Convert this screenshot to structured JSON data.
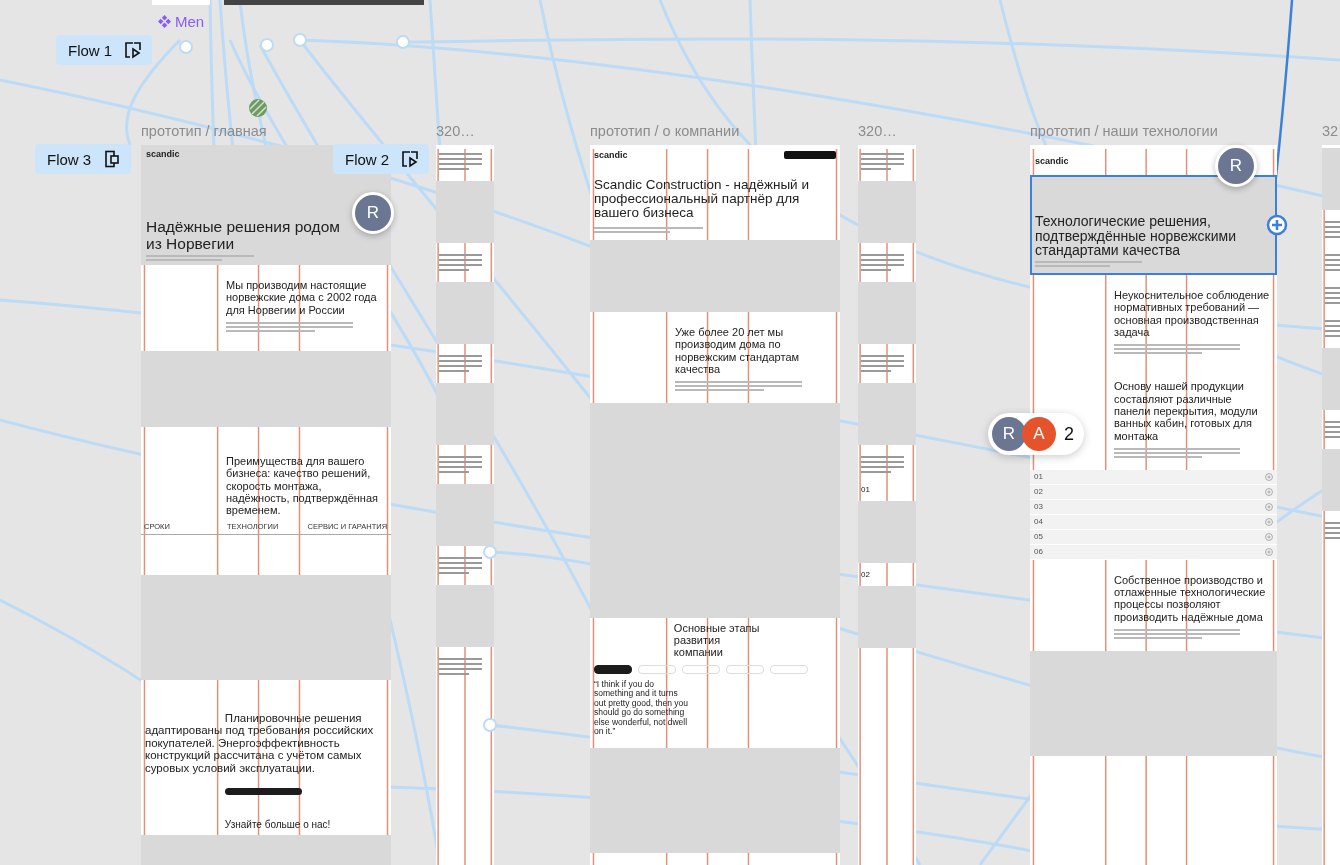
{
  "component_label": {
    "text": "Men"
  },
  "flows": [
    {
      "label": "Flow 1",
      "kind": "play"
    },
    {
      "label": "Flow 3",
      "kind": "device"
    },
    {
      "label": "Flow 2",
      "kind": "play"
    }
  ],
  "frames": [
    {
      "title": "прототип / главная",
      "kind": "desktop",
      "sections": [
        {
          "kind": "hero",
          "logo": "scandic",
          "heading": "Надёжные решения родом из Норвегии"
        },
        {
          "kind": "text",
          "heading": "Мы производим настоящие норвежские дома с 2002 года для Норвегии и России"
        },
        {
          "kind": "gray"
        },
        {
          "kind": "columns",
          "heading": "Преимущества для вашего бизнеса: качество решений, скорость монтажа, надёжность, подтверждённая временем.",
          "columns": [
            "СРОКИ",
            "ТЕХНОЛОГИИ",
            "СЕРВИС И ГАРАНТИЯ"
          ]
        },
        {
          "kind": "gray"
        },
        {
          "kind": "wide",
          "heading": "Планировочные решения адаптированы под требования российских покупателей. Энергоэффективность конструкций рассчитана с учётом самых суровых условий эксплуатации.",
          "subheading": "Узнайте больше о нас!"
        },
        {
          "kind": "gray"
        }
      ]
    },
    {
      "title": "320…",
      "kind": "mobile",
      "sections": [
        {
          "kind": "lines"
        },
        {
          "kind": "gray"
        },
        {
          "kind": "lines"
        },
        {
          "kind": "gray"
        },
        {
          "kind": "lines"
        },
        {
          "kind": "gray"
        },
        {
          "kind": "lines"
        },
        {
          "kind": "gray"
        },
        {
          "kind": "lines"
        },
        {
          "kind": "gray"
        },
        {
          "kind": "lines"
        }
      ]
    },
    {
      "title": "прототип / о компании",
      "kind": "desktop",
      "sections": [
        {
          "kind": "header",
          "logo": "scandic",
          "heading": "Scandic Construction - надёжный и профессиональный партнёр для вашего бизнеса"
        },
        {
          "kind": "gray"
        },
        {
          "kind": "text",
          "heading": "Уже более 20 лет мы производим дома по норвежским стандартам качества"
        },
        {
          "kind": "gray"
        },
        {
          "kind": "stages",
          "heading": "Основные этапы развития компании",
          "stages": [
            {
              "selected": true
            },
            {
              "selected": false
            },
            {
              "selected": false
            },
            {
              "selected": false
            },
            {
              "selected": false
            }
          ],
          "quote": "“I think if you do something and it turns out pretty good, then you should go do something else wonderful, not dwell on it.”"
        },
        {
          "kind": "gray"
        }
      ]
    },
    {
      "title": "320…",
      "kind": "mobile",
      "sections": [
        {
          "kind": "lines"
        },
        {
          "kind": "gray"
        },
        {
          "kind": "lines"
        },
        {
          "kind": "gray"
        },
        {
          "kind": "lines"
        },
        {
          "kind": "gray"
        },
        {
          "kind": "lines"
        },
        {
          "kind": "step",
          "number": "01"
        },
        {
          "kind": "gray"
        },
        {
          "kind": "step",
          "number": "02"
        },
        {
          "kind": "gray"
        }
      ]
    },
    {
      "title": "прототип / наши технологии",
      "kind": "desktop",
      "sections": [
        {
          "kind": "logo",
          "logo": "scandic"
        },
        {
          "kind": "hero",
          "selected": true,
          "heading": "Технологические решения, подтверждённые норвежскими стандартами качества"
        },
        {
          "kind": "text",
          "heading": "Неукоснительное соблюдение нормативных требований — основная производственная задача"
        },
        {
          "kind": "text",
          "heading": "Основу нашей продукции составляют различные панели перекрытия, модули ванных кабин, готовых для монтажа"
        },
        {
          "kind": "list",
          "items": [
            "01",
            "02",
            "03",
            "04",
            "05",
            "06"
          ]
        },
        {
          "kind": "text",
          "heading": "Собственное производство и отлаженные технологические процессы позволяют производить надёжные дома"
        },
        {
          "kind": "gray"
        }
      ]
    },
    {
      "title": "32",
      "kind": "mobile",
      "sections": [
        {
          "kind": "gray"
        },
        {
          "kind": "lines"
        },
        {
          "kind": "lines"
        },
        {
          "kind": "lines"
        },
        {
          "kind": "lines"
        },
        {
          "kind": "gray"
        },
        {
          "kind": "lines"
        },
        {
          "kind": "gray"
        },
        {
          "kind": "lines"
        }
      ]
    }
  ],
  "collaborators": [
    {
      "initial": "R",
      "color": "#6b7693"
    },
    {
      "initial": "R",
      "color": "#6b7693"
    }
  ],
  "group": {
    "avatars": [
      {
        "initial": "R",
        "color": "#6b7693"
      },
      {
        "initial": "A",
        "color": "#e5532d"
      }
    ],
    "count": "2"
  }
}
